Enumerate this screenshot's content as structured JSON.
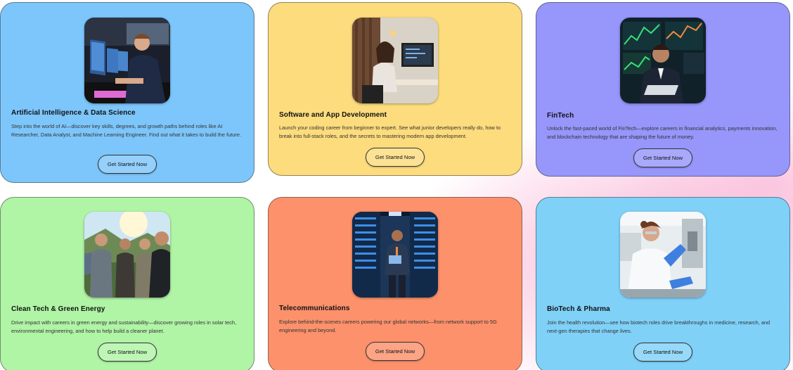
{
  "cards": [
    {
      "title": "Artificial Intelligence & Data Science",
      "description": "Step into the world of AI—discover key skills, degrees, and growth paths behind roles like AI Researcher, Data Analyst, and Machine Learning Engineer. Find out what it takes to build the future.",
      "button_label": "Get Started Now",
      "background": "#7dc6fb"
    },
    {
      "title": "Software and App Development",
      "description": "Launch your coding career from beginner to expert. See what junior developers really do, how to break into full-stack roles, and the secrets to mastering modern app development.",
      "button_label": "Get Started Now",
      "background": "#fcdc7d"
    },
    {
      "title": "FinTech",
      "description": "Unlock the fast-paced world of FinTech—explore careers in financial analytics, payments innovation, and blockchain technology that are shaping the future of money.",
      "button_label": "Get Started Now",
      "background": "#9696fb"
    },
    {
      "title": "Clean Tech & Green Energy",
      "description": "Drive impact with careers in green energy and sustainability—discover growing roles in solar tech, environmental engineering, and how to help build a cleaner planet.",
      "button_label": "Get Started Now",
      "background": "#b0f4a6"
    },
    {
      "title": "Telecommunications",
      "description": "Explore behind-the-scenes careers powering our global networks—from network support to 5G engineering and beyond.",
      "button_label": "Get Started Now",
      "background": "#fc916b"
    },
    {
      "title": "BioTech & Pharma",
      "description": "Join the health revolution—see how biotech roles drive breakthroughs in medicine, research, and next-gen therapies that change lives.",
      "button_label": "Get Started Now",
      "background": "#7fd1f8"
    }
  ]
}
